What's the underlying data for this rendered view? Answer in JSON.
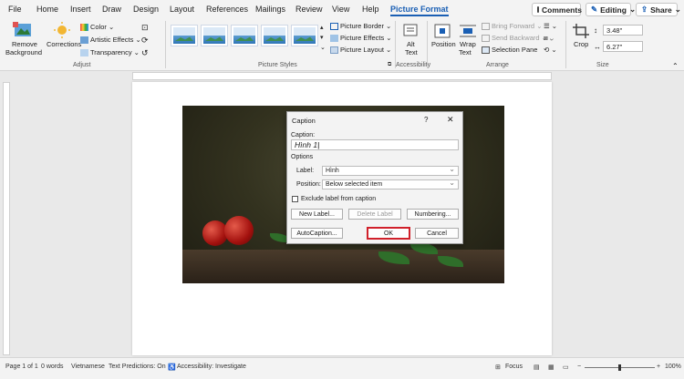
{
  "tabs": [
    "File",
    "Home",
    "Insert",
    "Draw",
    "Design",
    "Layout",
    "References",
    "Mailings",
    "Review",
    "View",
    "Help",
    "Picture Format"
  ],
  "top_buttons": {
    "comments": "Comments",
    "editing": "Editing",
    "share": "Share"
  },
  "ribbon": {
    "remove_bg": "Remove\nBackground",
    "remove_bg_1": "Remove",
    "remove_bg_2": "Background",
    "corrections": "Corrections",
    "color": "Color",
    "artistic": "Artistic Effects",
    "transparency": "Transparency",
    "adjust_label": "Adjust",
    "picture_styles_label": "Picture Styles",
    "picture_border": "Picture Border",
    "picture_effects": "Picture Effects",
    "picture_layout": "Picture Layout",
    "alt_text_1": "Alt",
    "alt_text_2": "Text",
    "accessibility_label": "Accessibility",
    "position": "Position",
    "wrap_1": "Wrap",
    "wrap_2": "Text",
    "bring_forward": "Bring Forward",
    "send_backward": "Send Backward",
    "selection_pane": "Selection Pane",
    "arrange_label": "Arrange",
    "crop": "Crop",
    "height": "3.48\"",
    "width": "6.27\"",
    "size_label": "Size"
  },
  "dialog": {
    "title": "Caption",
    "help": "?",
    "close": "✕",
    "caption_label": "Caption:",
    "caption_value": "Hình 1",
    "options_label": "Options",
    "label_label": "Label:",
    "label_value": "Hình",
    "position_label": "Position:",
    "position_value": "Below selected item",
    "exclude_label": "Exclude label from caption",
    "new_label": "New Label...",
    "delete_label": "Delete Label",
    "numbering": "Numbering...",
    "autocaption": "AutoCaption...",
    "ok": "OK",
    "cancel": "Cancel"
  },
  "status": {
    "page": "Page 1 of 1",
    "words": "0 words",
    "lang": "Vietnamese",
    "predictions": "Text Predictions: On",
    "accessibility": "Accessibility: Investigate",
    "focus": "Focus",
    "zoom": "100%"
  },
  "colors": {
    "accent": "#1a5fb4",
    "ok_highlight": "#d0202a"
  }
}
